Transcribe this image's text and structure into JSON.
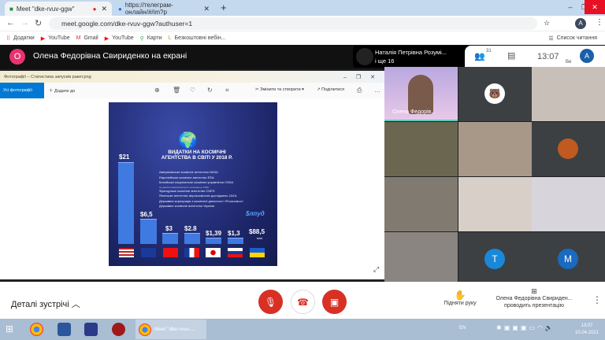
{
  "browser": {
    "tabs": [
      {
        "title": "Meet \"dke-rvuv-ggw\""
      },
      {
        "title": "https://телеграм-онлайн/#/im?p"
      }
    ],
    "url": "meet.google.com/dke-rvuv-ggw?authuser=1",
    "profile_initial": "A",
    "bookmarks": [
      "Додатки",
      "YouTube",
      "Gmail",
      "YouTube",
      "Карти",
      "Безкоштовні вебін..."
    ],
    "reading_list": "Список читання"
  },
  "meet": {
    "presenter_initial": "О",
    "presenter_banner": "Олена Федорівна Свириденко на екрані",
    "speaker_name": "Наталія Петрівна Розумі...",
    "speaker_more": "і ще 16",
    "participants_count": "31",
    "time": "13:07",
    "self_initial": "A",
    "self_label": "Ви",
    "tiles": [
      {
        "name": "Олена Федорів..."
      },
      {
        "initial": "T"
      },
      {
        "initial": "M"
      }
    ],
    "meeting_details": "Деталі зустрічі",
    "raise_hand": "Підняти руку",
    "presenting_name": "Олена Федорівна Свириден...",
    "presenting_label": "проводить презентацію"
  },
  "photos": {
    "title": "Фотографії – Статистика запусків ракет.png",
    "all_photos": "Усі фотографії",
    "add_to": "Додати до",
    "edit_create": "Змінити та створити",
    "share": "Поділитися"
  },
  "infographic": {
    "title_line1": "ВИДАТКИ НА КОСМІЧНІ",
    "title_line2": "АГЕНТСТВА В СВІТІ У 2018 Р.",
    "legend": [
      "Американське космічне агентство NASA",
      "Європейське космічне агентство ESA",
      "Китайське національне космічне управління CNSA",
      "за даними американського телеканалу CNBC",
      "Французьке космічне агентство CNES",
      "Японське агентство аерокосмічних досліджень JAXA",
      "Державна корпорація з космічної діяльності «Роскосмос»",
      "Державне космічне агентство України"
    ],
    "values": [
      "$21",
      "$6,5",
      "$3",
      "$2.8",
      "$1,39",
      "$1,3",
      "$88,5"
    ],
    "ukraine_unit": "млн",
    "brand": "$лпуд"
  },
  "taskbar": {
    "chrome_window": "Meet \"dke-rvuv-...",
    "lang": "EN",
    "clock_time": "13:07",
    "clock_date": "10.04.2021"
  }
}
